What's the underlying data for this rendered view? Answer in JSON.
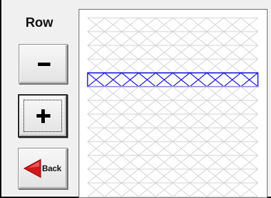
{
  "panel": {
    "title": "Row",
    "minus_button": "−",
    "plus_button": "+",
    "back_button": "Back"
  },
  "grid": {
    "row_count": 13,
    "selected_row": 5,
    "colors": {
      "pattern": "#d2d2d2",
      "selected_pattern": "#1a1ad6",
      "background": "#ffffff"
    }
  }
}
